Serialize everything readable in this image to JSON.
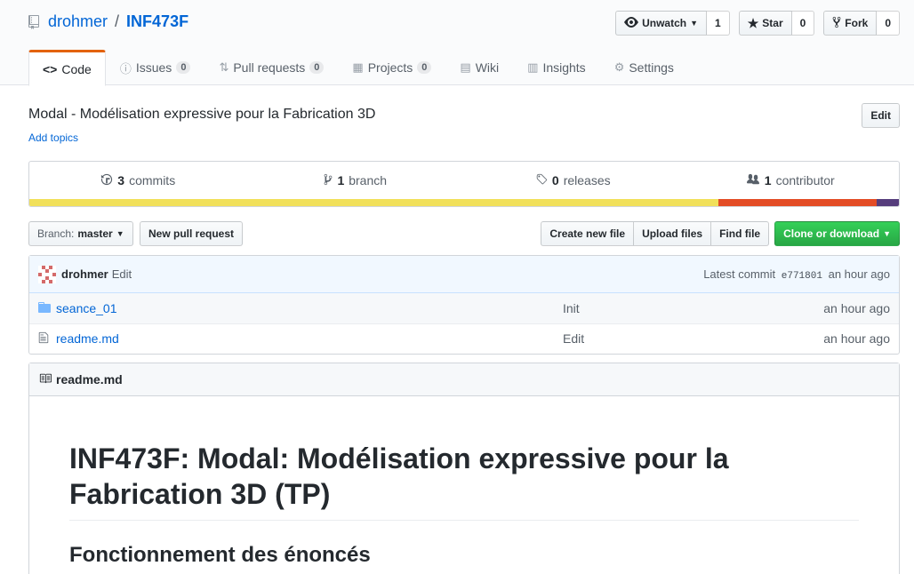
{
  "repo": {
    "owner": "drohmer",
    "separator": "/",
    "name": "INF473F"
  },
  "actions": {
    "watch_label": "Unwatch",
    "watch_count": "1",
    "star_label": "Star",
    "star_count": "0",
    "fork_label": "Fork",
    "fork_count": "0"
  },
  "nav": {
    "code": "Code",
    "issues": "Issues",
    "issues_count": "0",
    "pulls": "Pull requests",
    "pulls_count": "0",
    "projects": "Projects",
    "projects_count": "0",
    "wiki": "Wiki",
    "insights": "Insights",
    "settings": "Settings"
  },
  "description": "Modal - Modélisation expressive pour la Fabrication 3D",
  "add_topics": "Add topics",
  "edit_label": "Edit",
  "summary": {
    "commits_count": "3",
    "commits_label": "commits",
    "branch_count": "1",
    "branch_label": "branch",
    "releases_count": "0",
    "releases_label": "releases",
    "contributors_count": "1",
    "contributors_label": "contributor"
  },
  "languages": [
    {
      "color": "#f1e05a",
      "percent": 79.2
    },
    {
      "color": "#e34c26",
      "percent": 18.2
    },
    {
      "color": "#563d7c",
      "percent": 2.6
    }
  ],
  "file_nav": {
    "branch_label": "Branch:",
    "branch_value": "master",
    "new_pr": "New pull request",
    "create_file": "Create new file",
    "upload_files": "Upload files",
    "find_file": "Find file",
    "clone": "Clone or download"
  },
  "commit": {
    "author": "drohmer",
    "message": "Edit",
    "latest_label": "Latest commit",
    "sha": "e771801",
    "age": "an hour ago"
  },
  "files": [
    {
      "type": "folder",
      "name": "seance_01",
      "message": "Init",
      "age": "an hour ago"
    },
    {
      "type": "file",
      "name": "readme.md",
      "message": "Edit",
      "age": "an hour ago"
    }
  ],
  "readme": {
    "filename": "readme.md",
    "h1": "INF473F: Modal: Modélisation expressive pour la Fabrication 3D (TP)",
    "h2": "Fonctionnement des énoncés"
  }
}
